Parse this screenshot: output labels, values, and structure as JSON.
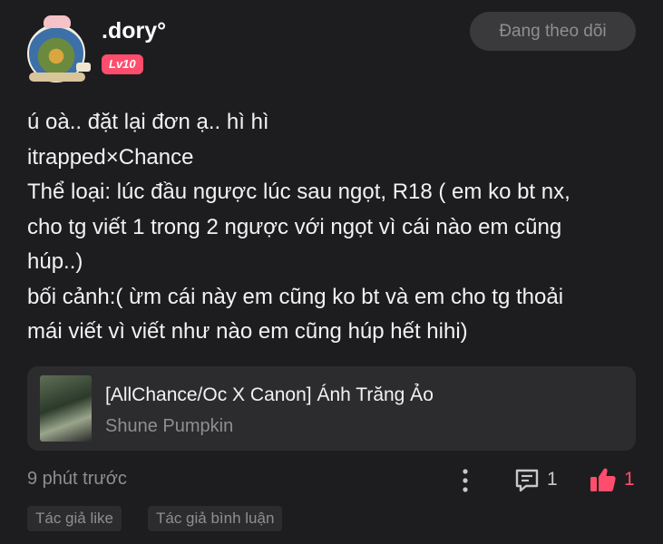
{
  "post": {
    "username": ".dory°",
    "level": "Lv10",
    "follow_button": "Đang theo dõi",
    "content_lines": [
      "ú oà.. đặt lại đơn ạ.. hì hì",
      "itrapped×Chance",
      "Thể loại: lúc đầu ngược lúc sau ngọt, R18 ( em ko bt nx,",
      "cho tg viết 1 trong 2 ngược với ngọt vì cái nào em cũng",
      "húp..)",
      "bối cảnh:( ừm cái này em cũng ko bt và em cho tg thoải",
      "mái viết vì viết như nào em cũng húp hết hihi)"
    ]
  },
  "linked_story": {
    "title": "[AllChance/Oc X Canon] Ánh Trăng Ảo",
    "author": "Shune Pumpkin"
  },
  "footer": {
    "time": "9 phút trước",
    "comment_count": "1",
    "like_count": "1",
    "tags": [
      "Tác giả like",
      "Tác giả bình luận"
    ]
  },
  "colors": {
    "background": "#1d1d1f",
    "accent": "#ff4d6d",
    "card": "#2c2c2e",
    "muted_text": "#8e8e93"
  },
  "icons": [
    "more-vertical-icon",
    "comment-icon",
    "thumbs-up-icon"
  ]
}
